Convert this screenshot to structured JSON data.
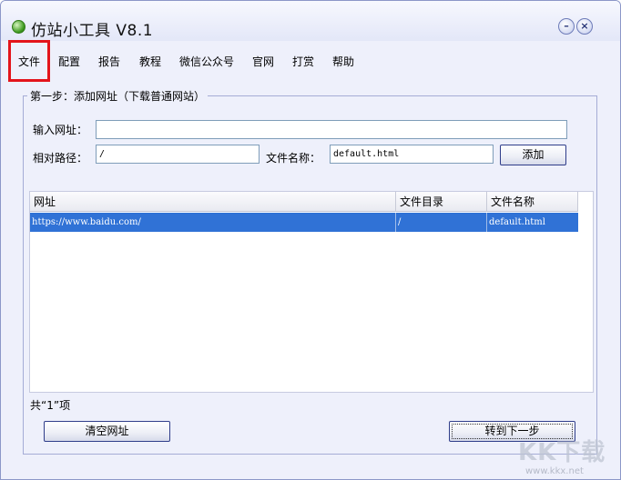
{
  "window": {
    "title": "仿站小工具 V8.1",
    "minimize_glyph": "–",
    "close_glyph": "×"
  },
  "menu": [
    {
      "label": "文件"
    },
    {
      "label": "配置"
    },
    {
      "label": "报告"
    },
    {
      "label": "教程"
    },
    {
      "label": "微信公众号"
    },
    {
      "label": "官网"
    },
    {
      "label": "打赏"
    },
    {
      "label": "帮助"
    }
  ],
  "step": {
    "title": "第一步：添加网址（下载普通网站）",
    "url_label": "输入网址：",
    "url_value": "",
    "path_label": "相对路径：",
    "path_value": "/",
    "filename_label": "文件名称：",
    "filename_value": "default.html",
    "add_button": "添加"
  },
  "table": {
    "columns": [
      "网址",
      "文件目录",
      "文件名称"
    ],
    "rows": [
      {
        "url": "https://www.baidu.com/",
        "dir": "/",
        "file": "default.html"
      }
    ]
  },
  "count_text": "共“1”项",
  "buttons": {
    "clear": "清空网址",
    "next": "转到下一步"
  },
  "watermark": {
    "logo": "KK下载",
    "url": "www.kkx.net"
  },
  "icons": {
    "app": "globe-icon",
    "minimize": "minimize-icon",
    "close": "close-icon"
  },
  "colors": {
    "selection": "#3072d6",
    "highlight_box": "#e3141b",
    "window_bg": "#eef0fb"
  }
}
